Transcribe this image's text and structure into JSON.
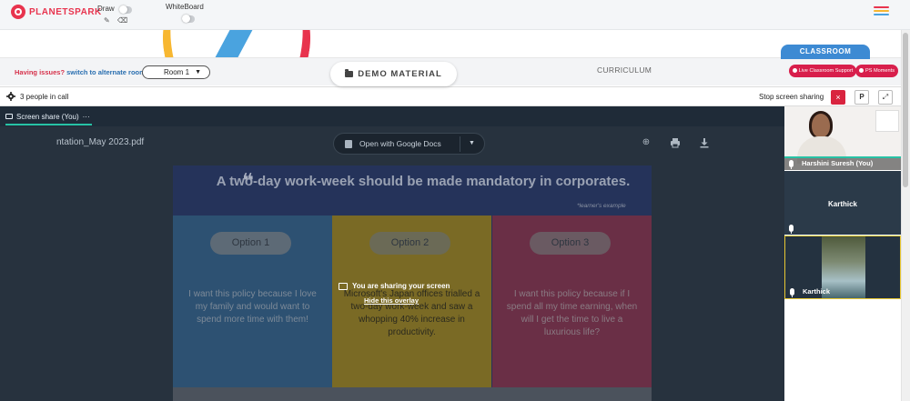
{
  "app": {
    "logo_text": "PLANETSPARK",
    "draw_label": "Draw",
    "whiteboard_label": "WhiteBoard",
    "hamburger_colors": [
      "#e8344e",
      "#f7b731",
      "#4aa3df"
    ]
  },
  "infobar": {
    "issues_text": "Having issues?",
    "alternate_link": "switch to alternate room",
    "room_value": "Room 1",
    "demo_material_label": "DEMO MATERIAL",
    "curriculum_label": "CURRICULUM",
    "classroom_label": "CLASSROOM",
    "live_support_label": "Live Classroom Support",
    "ps_moments_label": "PS Moments"
  },
  "callbar": {
    "people_count": "3 people in call",
    "stop_sharing_label": "Stop screen sharing",
    "stop_icon": "×",
    "p_label": "P",
    "expand_icon": "⤢"
  },
  "stage": {
    "share_tab_label": "Screen share (You)",
    "share_tab_more": "···",
    "pdf_filename": "ntation_May 2023.pdf",
    "open_google_label": "Open with Google Docs",
    "overlay_text": "You are sharing your screen",
    "hide_overlay_label": "Hide this overlay"
  },
  "slide": {
    "quote_mark": "❝",
    "title": "A two-day work-week should be made mandatory in corporates.",
    "note": "*learner's example",
    "options": [
      {
        "label": "Option 1",
        "text": "I want this policy because I love my family and would want to spend more time with them!"
      },
      {
        "label": "Option 2",
        "text": "Microsoft's Japan offices trialled a two-day work-week and saw a whopping 40% increase in productivity."
      },
      {
        "label": "Option 3",
        "text": "I want this policy because if I spend all my time earning, when will I get the time to live a luxurious life?"
      }
    ]
  },
  "participants": [
    {
      "name": "Harshini Suresh (You)"
    },
    {
      "name": "Karthick"
    },
    {
      "name": "Karthick"
    }
  ],
  "colors": {
    "brand_red": "#e8344e",
    "accent_teal": "#27c2a5",
    "classroom_blue": "#3d8ad3",
    "pill_red": "#d81f4c",
    "active_speaker": "#e8c733"
  }
}
